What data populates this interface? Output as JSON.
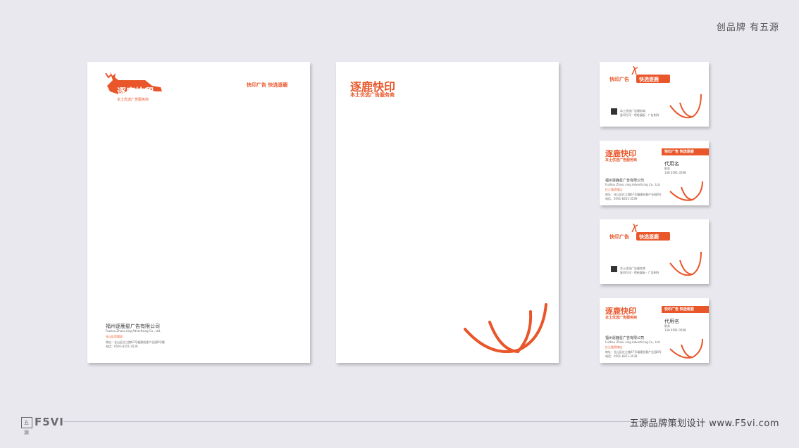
{
  "header": {
    "tagline": "创品牌 有五源"
  },
  "letterhead": {
    "logo_text": "逐鹿快印",
    "logo_sub": "本土优选广告服务商",
    "slogan": "快印广告  快选逐鹿",
    "company": "福州逐鹿星广告有限公司",
    "company_en": "Fuzhou Zhulu xing Advertising Co., Ltd.",
    "branch": "仓山区滨储部",
    "address": "地址：仓山区红江路67号福建创意产业园B号楼",
    "phone": "电话：0591-8351-3539"
  },
  "envelope": {
    "brand": "逐鹿快印",
    "sub": "本土优选广告服务商"
  },
  "card_front": {
    "slogan_left": "快印广告",
    "slogan_right": "快选逐鹿",
    "line1": "本土优选广告服务商",
    "line2": "复印打印 · 喷绘展板 · 广告制作"
  },
  "card_back": {
    "brand": "逐鹿快印",
    "sub": "本土优选广告服务商",
    "bar": "快印广告  快选逐鹿",
    "name": "代用名",
    "title": "职务",
    "phone": "138 0591 0598",
    "company": "福州逐鹿星广告有限公司",
    "company_en": "Fuzhou Zhulu xing Advertising Co., Ltd.",
    "branch": "红江路滨储店",
    "address": "地址：仓山区红江路67号福建创意产业园B号",
    "tel": "电话：0591-8351-3539"
  },
  "footer": {
    "logo_box": "五源",
    "logo": "F5VI",
    "text": "五源品牌策划设计  www.F5vi.com"
  },
  "colors": {
    "accent": "#e8562a",
    "background": "#e9e8ef"
  }
}
